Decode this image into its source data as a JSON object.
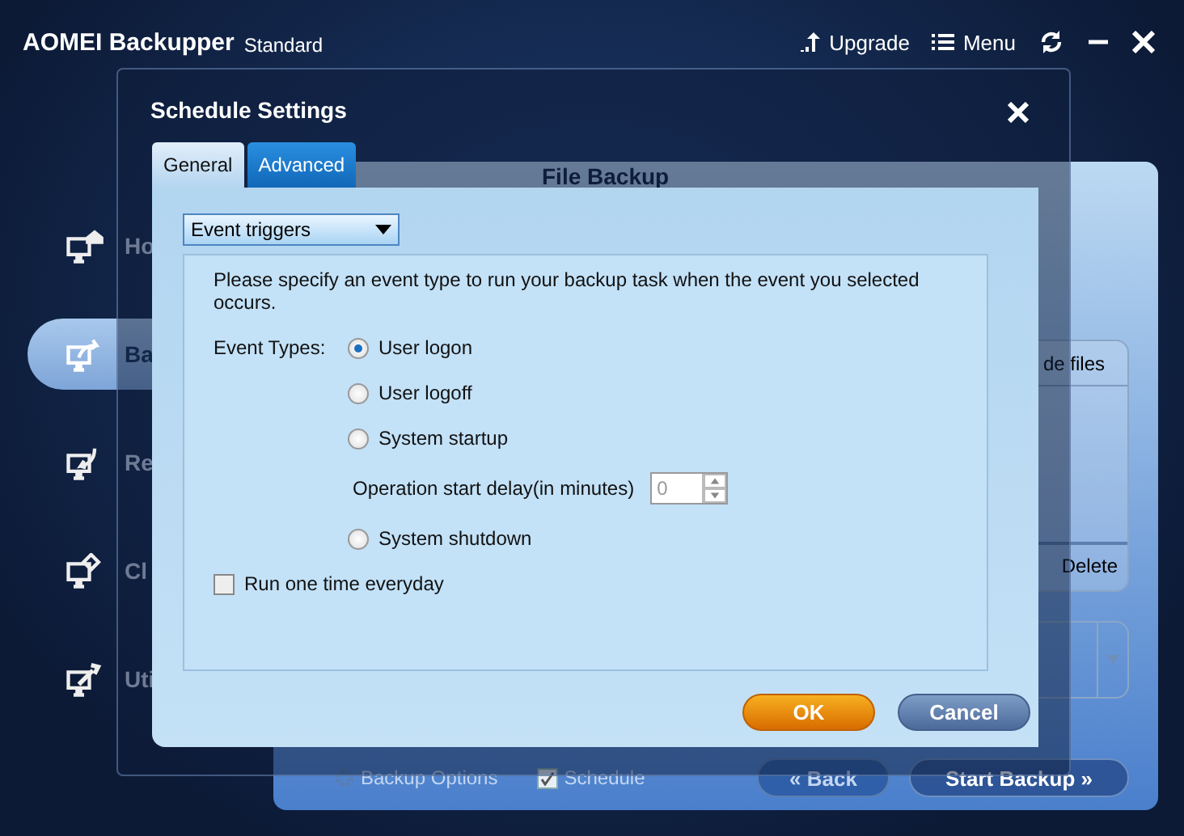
{
  "app": {
    "title": "AOMEI Backupper",
    "edition": "Standard",
    "actions": [
      {
        "kind": "upgrade",
        "label": "Upgrade"
      },
      {
        "kind": "menu",
        "label": "Menu"
      }
    ]
  },
  "sidebar": {
    "items": [
      {
        "kind": "home",
        "label": "Ho",
        "selected": false
      },
      {
        "kind": "backup",
        "label": "Ba",
        "selected": true
      },
      {
        "kind": "restore",
        "label": "Re",
        "selected": false
      },
      {
        "kind": "clone",
        "label": "Cl",
        "selected": false
      },
      {
        "kind": "utilities",
        "label": "Uti",
        "selected": false
      }
    ]
  },
  "main": {
    "title": "File Backup",
    "source_header": "de files",
    "source_action": "Delete",
    "options_link": "Backup Options",
    "schedule": {
      "label": "Schedule",
      "checked": true
    },
    "back_button": "« Back",
    "start_button": "Start Backup »"
  },
  "dialog": {
    "title": "Schedule Settings",
    "tabs": [
      {
        "label": "General",
        "selected": true
      },
      {
        "label": "Advanced",
        "selected": false
      }
    ],
    "trigger_select": "Event triggers",
    "instructions": "Please specify an event type to run your backup task when the event you selected occurs.",
    "event_types_label": "Event Types:",
    "options": [
      {
        "kind": "radio",
        "label": "User logon",
        "selected": true
      },
      {
        "kind": "radio",
        "label": "User logoff",
        "selected": false
      },
      {
        "kind": "radio",
        "label": "System startup",
        "selected": false
      },
      {
        "kind": "delay",
        "label": "Operation start delay(in minutes)",
        "value": "0"
      },
      {
        "kind": "radio",
        "label": "System shutdown",
        "selected": false
      }
    ],
    "run_once": {
      "label": "Run one time everyday",
      "checked": false
    },
    "buttons": [
      {
        "kind": "primary",
        "label": "OK"
      },
      {
        "kind": "secondary",
        "label": "Cancel"
      }
    ]
  }
}
